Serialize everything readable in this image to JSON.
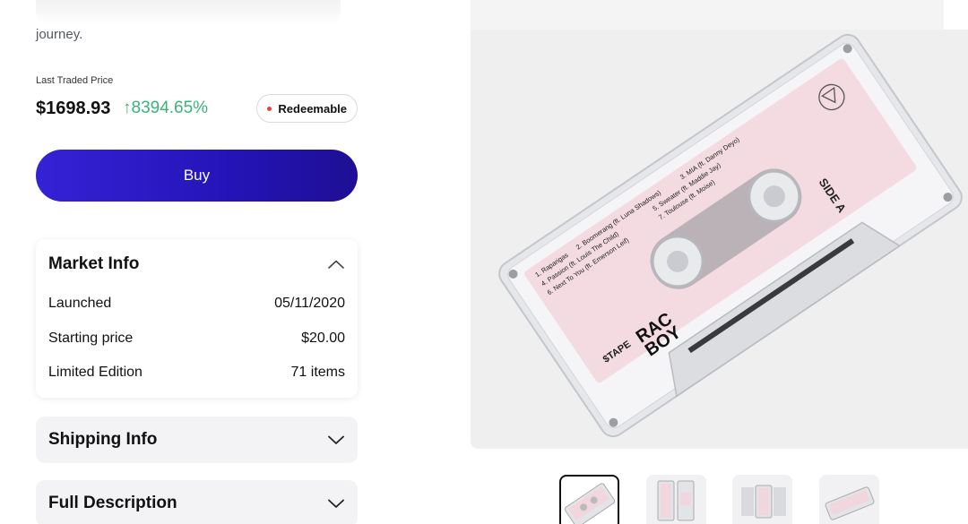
{
  "description": {
    "tail": "journey."
  },
  "price": {
    "label": "Last Traded Price",
    "value": "$1698.93",
    "change": "8394.65%",
    "badge": "Redeemable"
  },
  "buy_label": "Buy",
  "market_info": {
    "title": "Market Info",
    "rows": [
      {
        "label": "Launched",
        "value": "05/11/2020"
      },
      {
        "label": "Starting price",
        "value": "$20.00"
      },
      {
        "label": "Limited Edition",
        "value": "71 items"
      }
    ]
  },
  "shipping_info": {
    "title": "Shipping Info"
  },
  "full_description": {
    "title": "Full Description"
  },
  "cassette": {
    "brand": "$TAPE",
    "artist_line1": "RAC",
    "artist_line2": "BOY",
    "side": "SIDE A",
    "tracks": [
      "1. Raparigas",
      "2. Boomerang (ft. Luna Shadows)",
      "3. MIA (ft. Danny Deyo)",
      "4. Passion (ft. Louis The Child)",
      "5. Sweater (ft. Maddie Jay)",
      "6. Next To You (ft. Emerson Leif)",
      "7. Toulouse (ft. Moise)"
    ]
  },
  "colors": {
    "accent": "#2a18c4",
    "positive": "#3bb37a",
    "badge_dot": "#e0453c",
    "tape_label": "#f3dbe1"
  }
}
